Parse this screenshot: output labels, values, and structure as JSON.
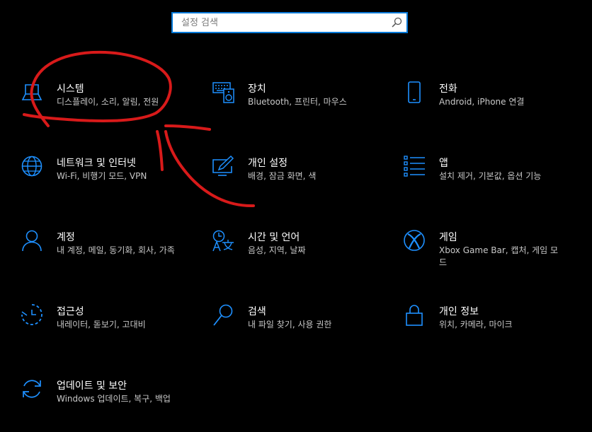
{
  "search": {
    "placeholder": "설정 검색"
  },
  "accent_color": "#0078d7",
  "annotation_color": "#d81a1a",
  "tiles": [
    {
      "title": "시스템",
      "desc": "디스플레이, 소리, 알림, 전원",
      "icon": "laptop-icon"
    },
    {
      "title": "장치",
      "desc": "Bluetooth, 프린터, 마우스",
      "icon": "keyboard-speaker-icon"
    },
    {
      "title": "전화",
      "desc": "Android, iPhone 연결",
      "icon": "phone-icon"
    },
    {
      "title": "네트워크 및 인터넷",
      "desc": "Wi-Fi, 비행기 모드, VPN",
      "icon": "globe-icon"
    },
    {
      "title": "개인 설정",
      "desc": "배경, 잠금 화면, 색",
      "icon": "monitor-pen-icon"
    },
    {
      "title": "앱",
      "desc": "설치 제거, 기본값, 옵션 기능",
      "icon": "apps-list-icon"
    },
    {
      "title": "계정",
      "desc": "내 계정, 메일, 동기화, 회사, 가족",
      "icon": "person-icon"
    },
    {
      "title": "시간 및 언어",
      "desc": "음성, 지역, 날짜",
      "icon": "time-language-icon"
    },
    {
      "title": "게임",
      "desc": "Xbox Game Bar, 캡처, 게임 모드",
      "icon": "xbox-icon"
    },
    {
      "title": "접근성",
      "desc": "내레이터, 돋보기, 고대비",
      "icon": "ease-of-access-icon"
    },
    {
      "title": "검색",
      "desc": "내 파일 찾기, 사용 권한",
      "icon": "magnifier-icon"
    },
    {
      "title": "개인 정보",
      "desc": "위치, 카메라, 마이크",
      "icon": "lock-icon"
    },
    {
      "title": "업데이트 및 보안",
      "desc": "Windows 업데이트, 복구, 백업",
      "icon": "sync-icon"
    }
  ]
}
